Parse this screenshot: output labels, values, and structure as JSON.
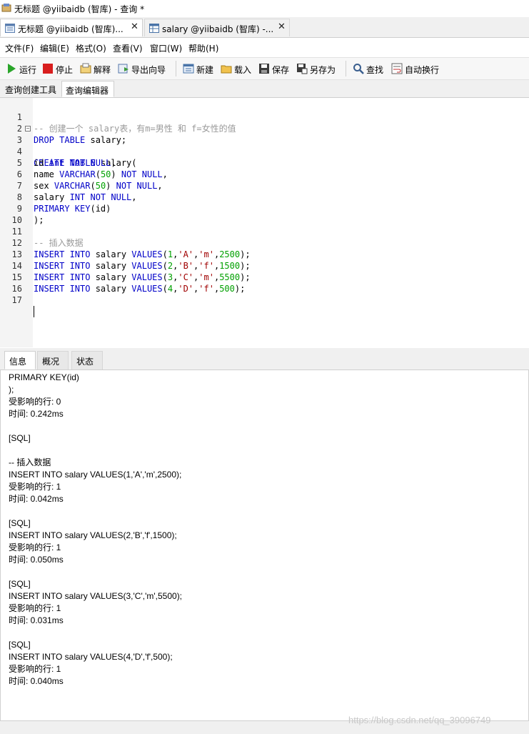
{
  "window": {
    "title": "无标题 @yiibaidb (智库) - 查询 *"
  },
  "doc_tabs": [
    {
      "label": "无标题 @yiibaidb (智库)...",
      "close": "✕"
    },
    {
      "label": "salary @yiibaidb (智库) -...",
      "close": "✕"
    }
  ],
  "menu": [
    "文件(F)",
    "编辑(E)",
    "格式(O)",
    "查看(V)",
    "窗口(W)",
    "帮助(H)"
  ],
  "toolbar": {
    "run": "运行",
    "stop": "停止",
    "explain": "解释",
    "export_wizard": "导出向导",
    "new": "新建",
    "load": "载入",
    "save": "保存",
    "save_as": "另存为",
    "find": "查找",
    "word_wrap": "自动换行"
  },
  "editor_tabs": [
    "查询创建工具",
    "查询编辑器"
  ],
  "editor": {
    "line_numbers": [
      "1",
      "2",
      "3",
      "4",
      "5",
      "6",
      "7",
      "8",
      "9",
      "10",
      "11",
      "12",
      "13",
      "14",
      "15",
      "16",
      "17"
    ],
    "lines": {
      "l1": "-- 创建一个 salary表，有m=男性 和 f=女性的值",
      "l2a": "DROP TABLE",
      "l2b": " salary;",
      "l3a": "CREATE TABLE",
      "l3b": " salary(",
      "l4a": "id ",
      "l4b": "int NOT NULL",
      "l4c": ",",
      "l5a": "name ",
      "l5b": "VARCHAR",
      "l5c": "(",
      "l5d": "50",
      "l5e": ") ",
      "l5f": "NOT NULL",
      "l5g": ",",
      "l6a": "sex ",
      "l6b": "VARCHAR",
      "l6c": "(",
      "l6d": "50",
      "l6e": ") ",
      "l6f": "NOT NULL",
      "l6g": ",",
      "l7a": "salary ",
      "l7b": "INT NOT NULL",
      "l7c": ",",
      "l8a": "PRIMARY KEY",
      "l8b": "(id)",
      "l9": ");",
      "l11": "-- 插入数据",
      "ins": [
        {
          "kw1": "INSERT INTO",
          "tbl": " salary ",
          "kw2": "VALUES",
          "p1": "(",
          "n1": "1",
          "c1": ",",
          "s1": "'A'",
          "c2": ",",
          "s2": "'m'",
          "c3": ",",
          "n2": "2500",
          "p2": ");"
        },
        {
          "kw1": "INSERT INTO",
          "tbl": " salary ",
          "kw2": "VALUES",
          "p1": "(",
          "n1": "2",
          "c1": ",",
          "s1": "'B'",
          "c2": ",",
          "s2": "'f'",
          "c3": ",",
          "n2": "1500",
          "p2": ");"
        },
        {
          "kw1": "INSERT INTO",
          "tbl": " salary ",
          "kw2": "VALUES",
          "p1": "(",
          "n1": "3",
          "c1": ",",
          "s1": "'C'",
          "c2": ",",
          "s2": "'m'",
          "c3": ",",
          "n2": "5500",
          "p2": ");"
        },
        {
          "kw1": "INSERT INTO",
          "tbl": " salary ",
          "kw2": "VALUES",
          "p1": "(",
          "n1": "4",
          "c1": ",",
          "s1": "'D'",
          "c2": ",",
          "s2": "'f'",
          "c3": ",",
          "n2": "500",
          "p2": ");"
        }
      ]
    }
  },
  "result_tabs": [
    "信息",
    "概况",
    "状态"
  ],
  "messages": [
    "PRIMARY KEY(id)",
    ");",
    "受影响的行: 0",
    "时间: 0.242ms",
    "",
    "[SQL]",
    "",
    "-- 插入数据",
    "INSERT INTO salary VALUES(1,'A','m',2500);",
    "受影响的行: 1",
    "时间: 0.042ms",
    "",
    "[SQL]",
    "INSERT INTO salary VALUES(2,'B','f',1500);",
    "受影响的行: 1",
    "时间: 0.050ms",
    "",
    "[SQL]",
    "INSERT INTO salary VALUES(3,'C','m',5500);",
    "受影响的行: 1",
    "时间: 0.031ms",
    "",
    "[SQL]",
    "INSERT INTO salary VALUES(4,'D','f',500);",
    "受影响的行: 1",
    "时间: 0.040ms"
  ],
  "watermark": "https://blog.csdn.net/qq_39096749",
  "colors": {
    "keyword": "#0000c8",
    "number": "#00a000",
    "string": "#a00000",
    "comment": "#9a9a9a"
  }
}
